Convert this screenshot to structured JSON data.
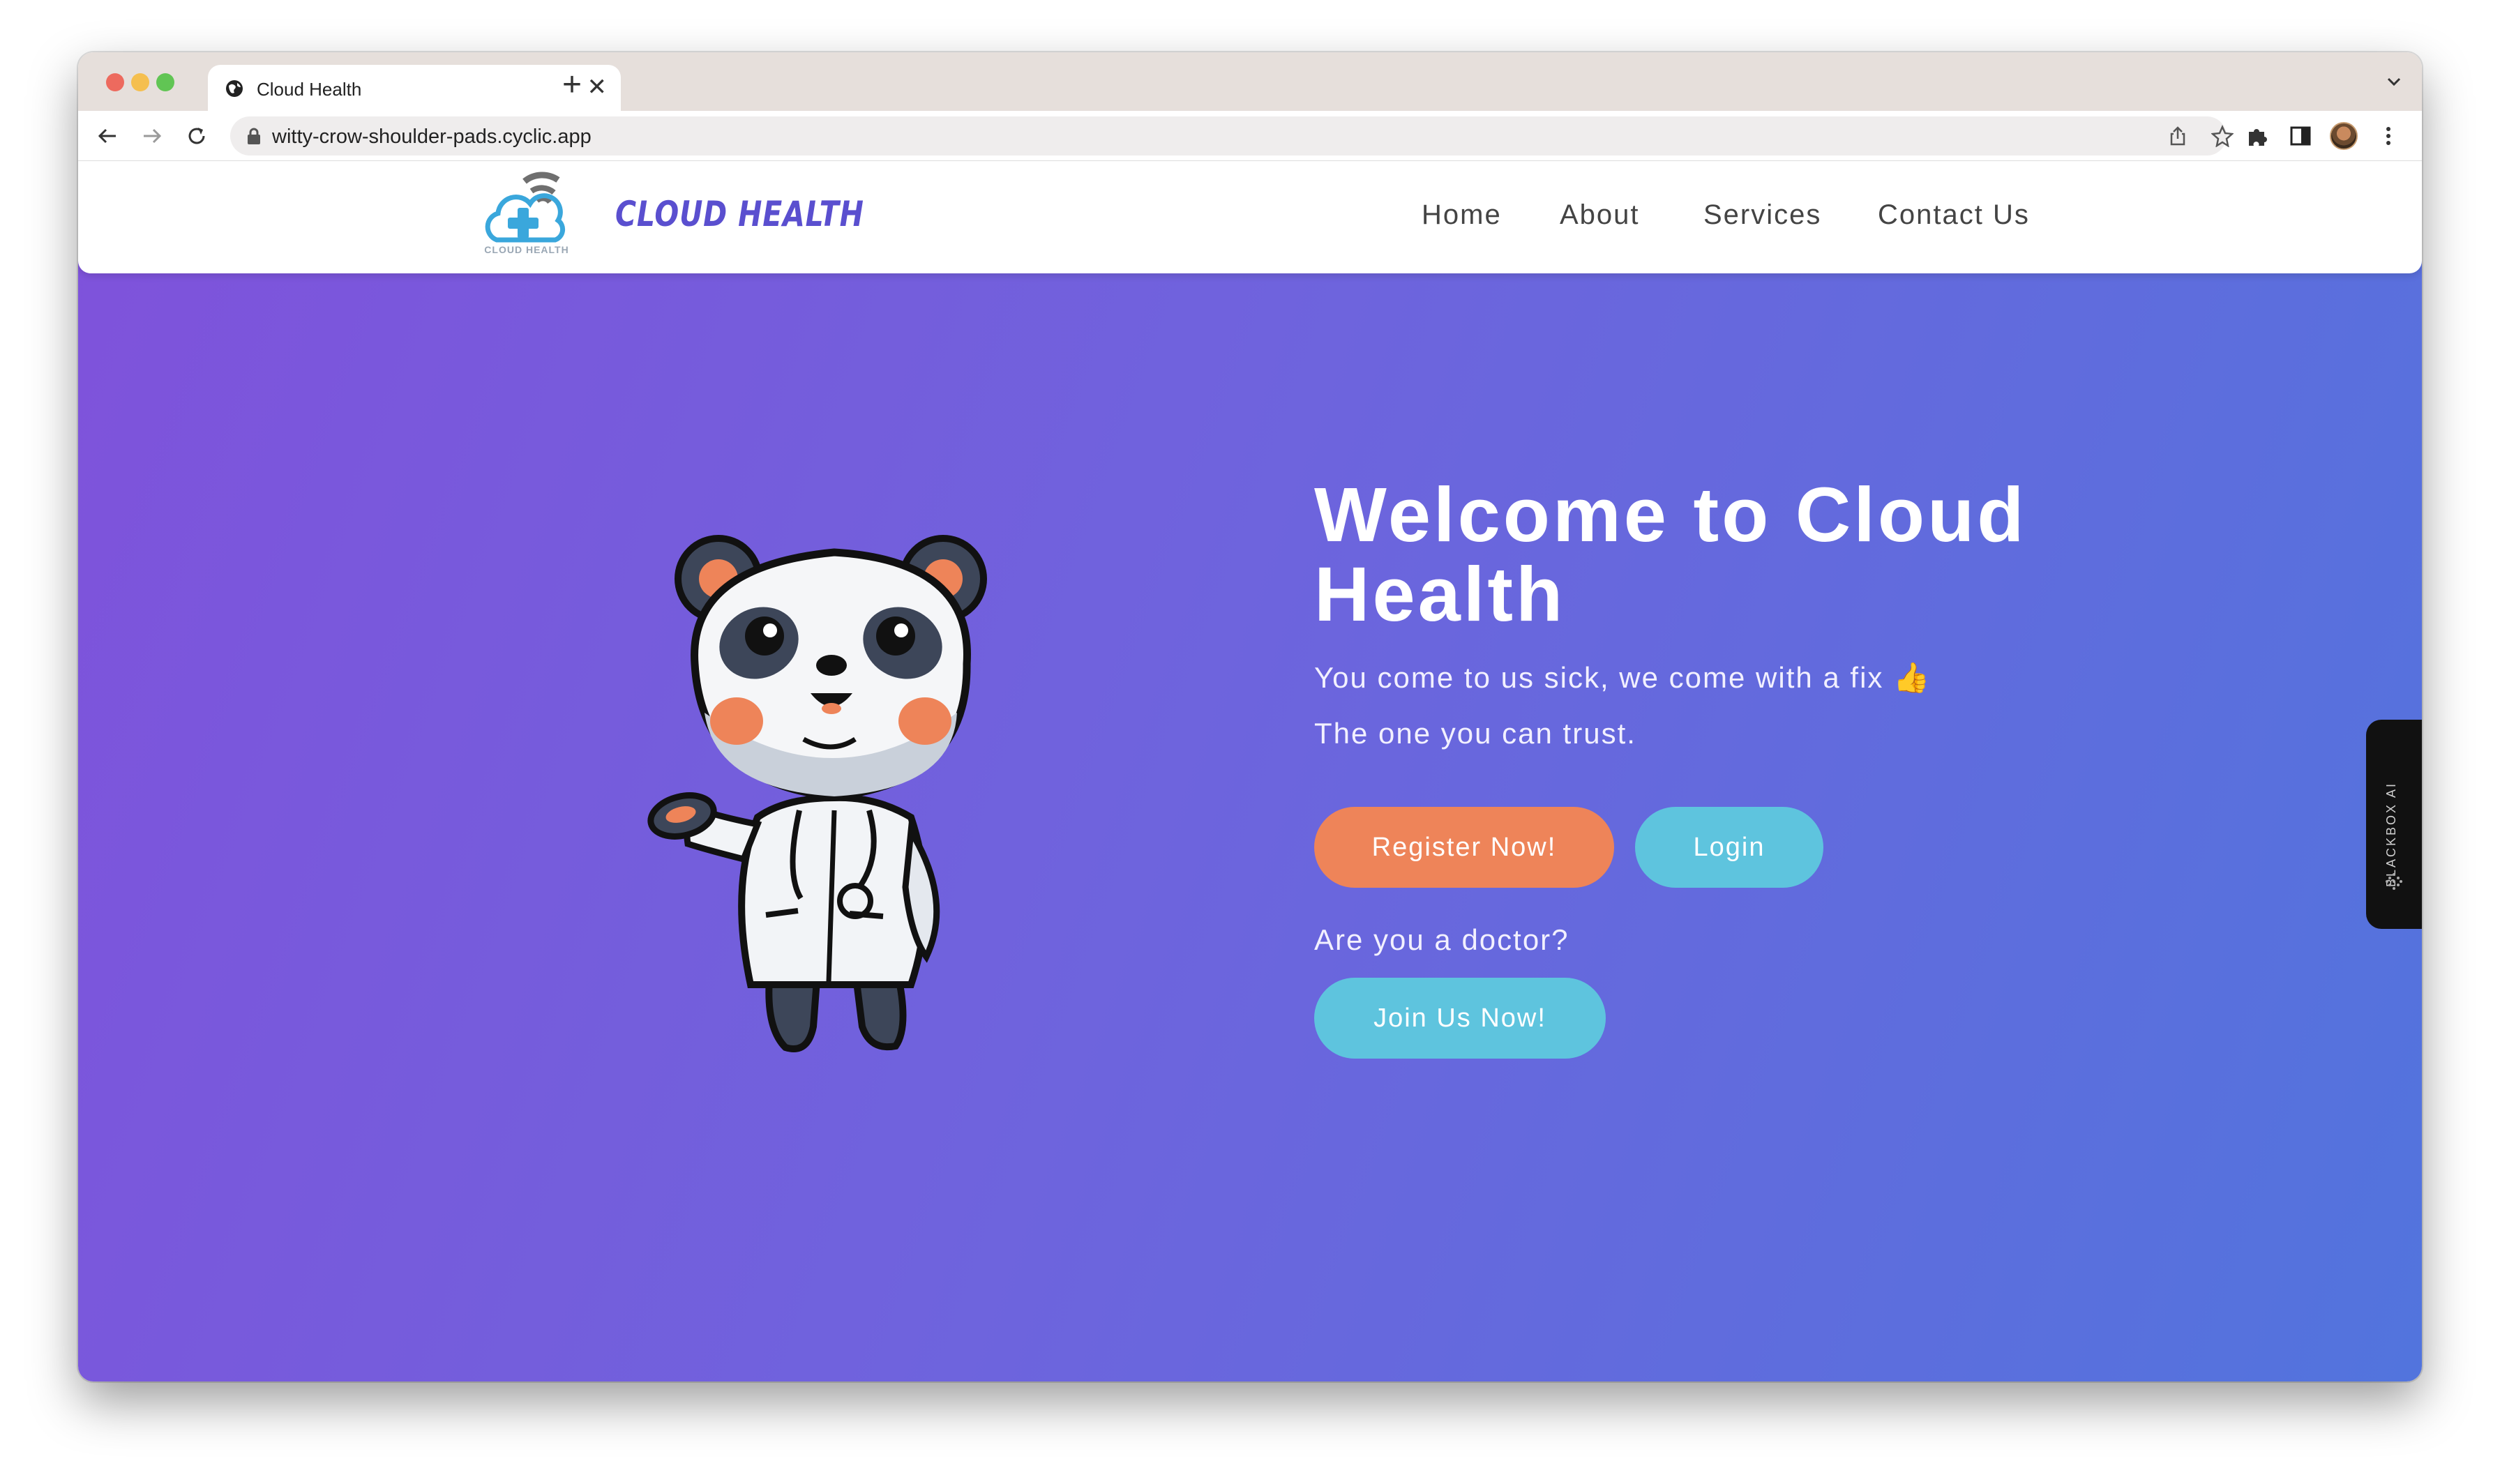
{
  "browser": {
    "tab_title": "Cloud Health",
    "tab_close": "✕",
    "new_tab": "+",
    "url": "witty-crow-shoulder-pads.cyclic.app"
  },
  "site": {
    "logo_caption": "CLOUD HEALTH",
    "brand": "CLOUD HEALTH",
    "nav": [
      "Home",
      "About",
      "Services",
      "Contact Us"
    ]
  },
  "hero": {
    "title": "Welcome to Cloud Health",
    "tagline": "You come to us sick, we come with a fix 👍",
    "subtagline": "The one you can trust.",
    "register_label": "Register Now!",
    "login_label": "Login",
    "doctor_prompt": "Are you a doctor?",
    "join_label": "Join Us Now!"
  },
  "blackbox": {
    "label": "BLACKBOX AI"
  },
  "colors": {
    "accent_orange": "#ee8459",
    "accent_teal": "#5ec4de",
    "brand_purple": "#5a4fcf",
    "gradient_start": "#7f52db",
    "gradient_end": "#5274dd"
  }
}
